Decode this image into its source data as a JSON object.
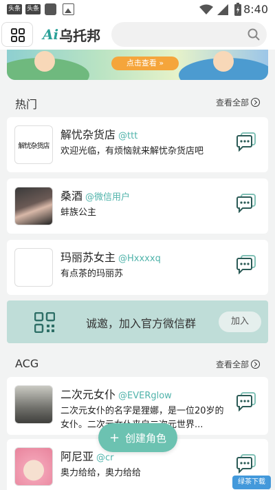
{
  "status_bar": {
    "badges": [
      "头条",
      "头条"
    ],
    "time": "8:40"
  },
  "header": {
    "logo_mark": "Ai",
    "logo_text": "乌托邦"
  },
  "banner": {
    "button_label": "点击查看 »"
  },
  "sections": {
    "hot": {
      "title": "热门",
      "more_label": "查看全部"
    },
    "acg": {
      "title": "ACG",
      "more_label": "查看全部"
    }
  },
  "hot_cards": [
    {
      "name": "解忧杂货店",
      "handle": "@ttt",
      "desc": "欢迎光临，有烦恼就来解忧杂货店吧",
      "avatar_text": "解忧杂货店"
    },
    {
      "name": "桑酒",
      "handle": "@微信用户",
      "desc": "蚌族公主"
    },
    {
      "name": "玛丽苏女主",
      "handle": "@Hxxxxq",
      "desc": "有点茶的玛丽苏"
    }
  ],
  "invite": {
    "text": "诚邀，加入官方微信群",
    "button_label": "加入"
  },
  "acg_cards": [
    {
      "name": "二次元女仆",
      "handle": "@EVERglow",
      "desc": "二次元女仆的名字是狸娜，是一位20岁的女仆。二次元女仆来自二次元世界..."
    },
    {
      "name": "阿尼亚",
      "handle": "@cr",
      "desc": "奥力给给，奥力给给"
    }
  ],
  "create_button": {
    "label": "创建角色",
    "icon": "plus-icon"
  },
  "watermark": {
    "text": "绿茶下载"
  },
  "colors": {
    "accent": "#4fb3aa",
    "invite_bg": "#bfddd8",
    "create_bg": "#6cc2b1"
  }
}
